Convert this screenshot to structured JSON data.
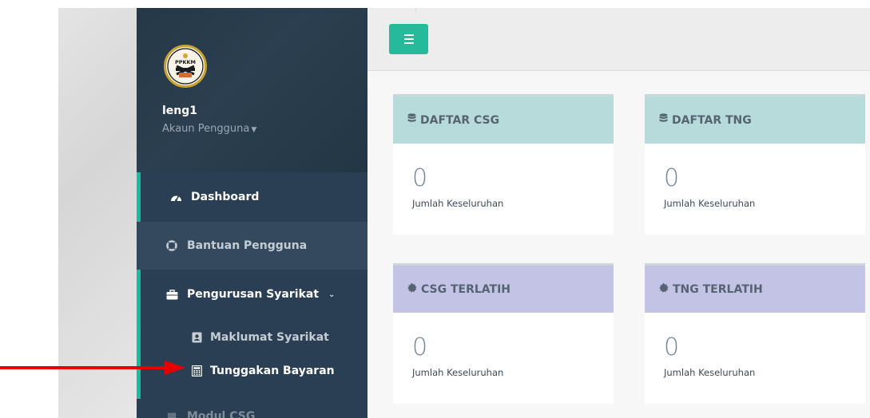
{
  "sidebar": {
    "username": "leng1",
    "account_label": "Akaun Pengguna",
    "logo_text": "PPKKM",
    "nav": {
      "dashboard": "Dashboard",
      "bantuan": "Bantuan Pengguna",
      "pengurusan": "Pengurusan Syarikat",
      "maklumat": "Maklumat Syarikat",
      "tunggakan": "Tunggakan Bayaran",
      "next_partial": "Modul CSG"
    }
  },
  "cards": {
    "daftar_csg": {
      "title": "DAFTAR CSG",
      "value": "0",
      "label": "Jumlah Keseluruhan"
    },
    "daftar_tng": {
      "title": "DAFTAR TNG",
      "value": "0",
      "label": "Jumlah Keseluruhan"
    },
    "csg_terlatih": {
      "title": "CSG TERLATIH",
      "value": "0",
      "label": "Jumlah Keseluruhan"
    },
    "tng_terlatih": {
      "title": "TNG TERLATIH",
      "value": "0",
      "label": "Jumlah Keseluruhan"
    }
  },
  "icons": {
    "toggle": "menu-icon",
    "dashboard": "tachometer-icon",
    "bantuan": "lifebuoy-icon",
    "pengurusan": "briefcase-icon",
    "maklumat": "address-card-icon",
    "tunggakan": "calculator-icon",
    "daftar": "database-icon",
    "terlatih": "certificate-icon"
  },
  "colors": {
    "sidebar_bg": "#2a3f54",
    "accent_green": "#1abb9c",
    "toggle_bg": "#26b99a",
    "card_head_teal": "#b7dbdb",
    "card_head_purple": "#c3c3e6",
    "arrow_red": "#e60000"
  }
}
